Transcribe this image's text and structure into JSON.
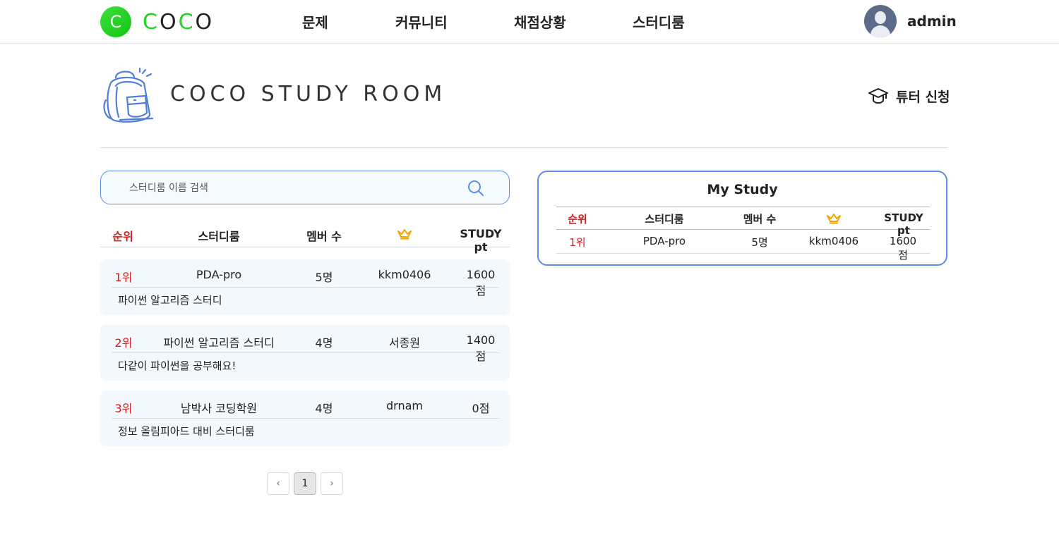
{
  "header": {
    "logo_letter": "C",
    "logo_text_parts": [
      "C",
      "O",
      "C",
      "O"
    ],
    "nav": [
      {
        "label": "문제"
      },
      {
        "label": "커뮤니티"
      },
      {
        "label": "채점상황"
      },
      {
        "label": "스터디룸"
      }
    ],
    "username": "admin"
  },
  "page": {
    "title": "COCO STUDY ROOM",
    "tutor_label": "튜터 신청"
  },
  "search": {
    "placeholder": "스터디룸 이름 검색",
    "value": ""
  },
  "list": {
    "columns": [
      "순위",
      "스터디룸",
      "멤버 수",
      "STUDY pt"
    ],
    "leader_icon": "crown-icon",
    "rows": [
      {
        "rank": "1위",
        "name": "PDA-pro",
        "members": "5명",
        "leader": "kkm0406",
        "points": "1600점",
        "description": "파이썬 알고리즘 스터디"
      },
      {
        "rank": "2위",
        "name": "파이썬 알고리즘 스터디",
        "members": "4명",
        "leader": "서종원",
        "points": "1400점",
        "description": "다같이 파이썬을 공부해요!"
      },
      {
        "rank": "3위",
        "name": "남박사 코딩학원",
        "members": "4명",
        "leader": "drnam",
        "points": "0점",
        "description": "정보 올림피아드 대비 스터디룸"
      }
    ]
  },
  "pagination": {
    "prev": "‹",
    "pages": [
      "1"
    ],
    "current": "1",
    "next": "›"
  },
  "my_study": {
    "title": "My Study",
    "columns": [
      "순위",
      "스터디룸",
      "멤버 수",
      "STUDY pt"
    ],
    "rows": [
      {
        "rank": "1위",
        "name": "PDA-pro",
        "members": "5명",
        "leader": "kkm0406",
        "points": "1600점"
      }
    ]
  },
  "colors": {
    "accent_green": "#21d421",
    "accent_blue": "#5a8ee6",
    "rank_red": "#d81b1b",
    "crown": "#f5a300",
    "card_bg": "#f3f8fc"
  }
}
